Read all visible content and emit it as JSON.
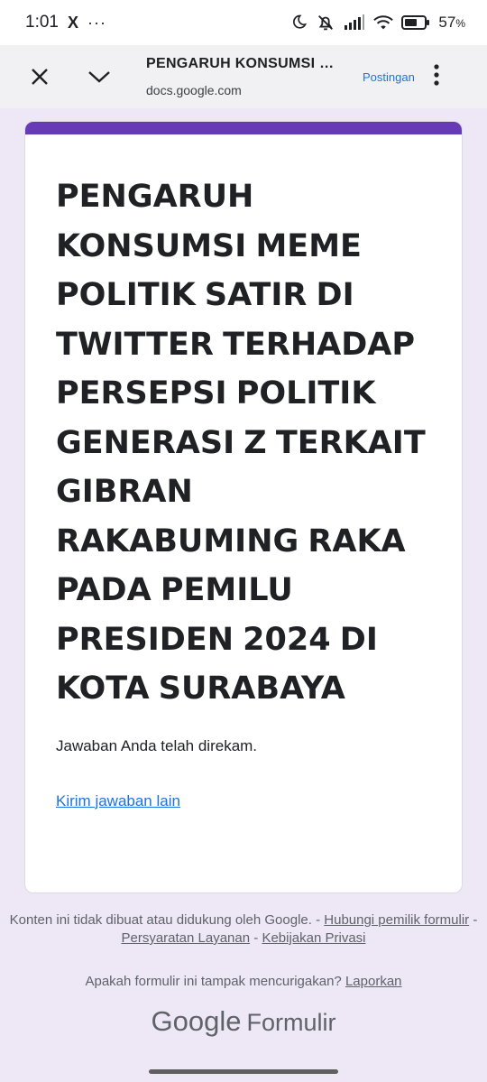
{
  "status_bar": {
    "time": "1:01",
    "app_icon": "X",
    "more": "···",
    "battery_percent": "57",
    "battery_unit": "%",
    "icons": [
      "moon-icon",
      "mute-icon",
      "signal-icon",
      "wifi-icon",
      "battery-icon"
    ]
  },
  "browser": {
    "title": "PENGARUH KONSUMSI MEME POLITIK SATIR DI TWITTER",
    "url": "docs.google.com",
    "action_label": "Postingan"
  },
  "form": {
    "accent_color": "#673ab7",
    "title": "PENGARUH KONSUMSI MEME POLITIK SATIR DI TWITTER TERHADAP PERSEPSI POLITIK GENERASI Z TERKAIT GIBRAN RAKABUMING RAKA PADA PEMILU PRESIDEN 2024 DI KOTA SURABAYA",
    "confirmation": "Jawaban Anda telah direkam.",
    "resubmit_link": "Kirim jawaban lain"
  },
  "footer": {
    "disclaimer": "Konten ini tidak dibuat atau didukung oleh Google.",
    "sep": " - ",
    "contact_owner": "Hubungi pemilik formulir",
    "terms": "Persyaratan Layanan",
    "privacy": "Kebijakan Privasi",
    "report_question": "Apakah formulir ini tampak mencurigakan?",
    "report_link": "Laporkan",
    "brand_google": "Google",
    "brand_forms": "Formulir"
  }
}
